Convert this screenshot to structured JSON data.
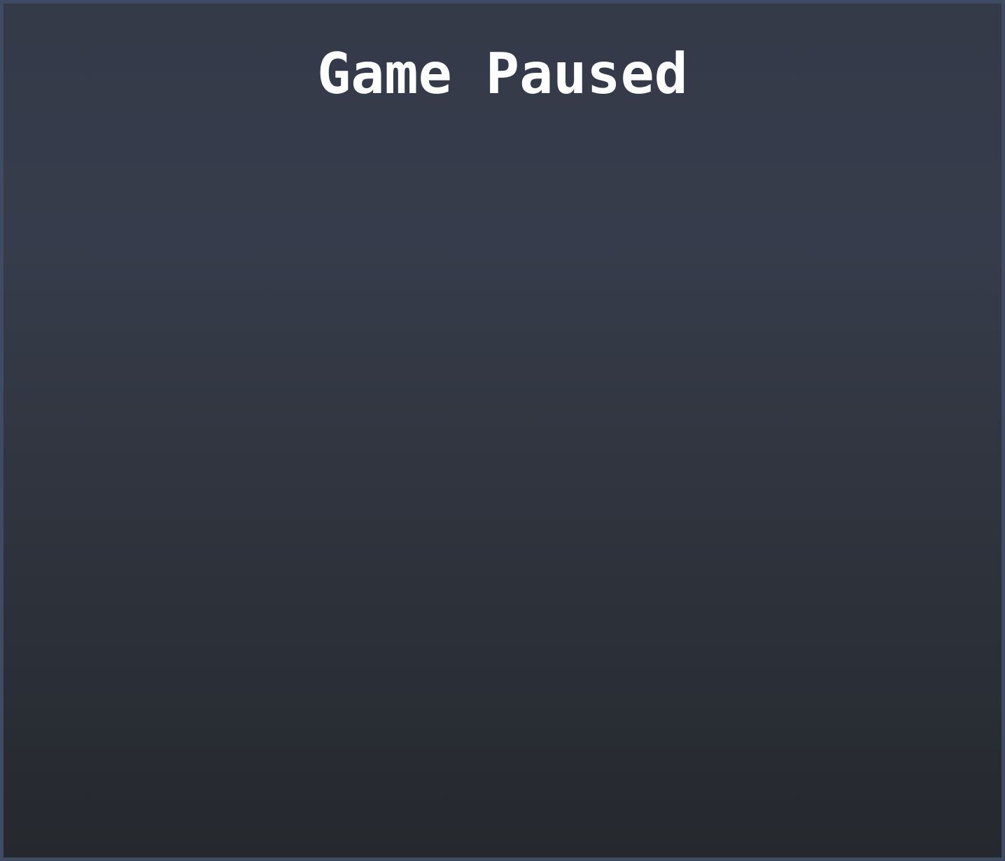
{
  "pause_screen": {
    "title": "Game Paused"
  },
  "colors": {
    "border": "#3f4b63",
    "background_top": "#343a48",
    "background_bottom": "#25282d",
    "title_text": "#ffffff"
  }
}
